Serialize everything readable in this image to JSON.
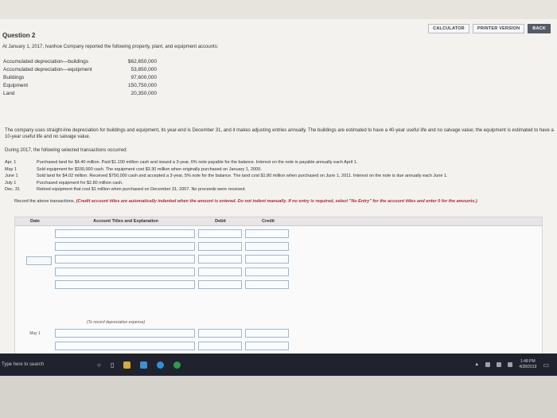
{
  "toolbar": {
    "calculator": "CALCULATOR",
    "printer_version": "PRINTER VERSION",
    "back": "BACK"
  },
  "question": {
    "title": "Question 2",
    "intro": "At January 1, 2017, Ivanhoe Company reported the following property, plant, and equipment accounts:"
  },
  "accounts": [
    {
      "name": "Accumulated depreciation—buildings",
      "value": "$62,650,000"
    },
    {
      "name": "Accumulated depreciation—equipment",
      "value": "53,850,000"
    },
    {
      "name": "Buildings",
      "value": "97,600,000"
    },
    {
      "name": "Equipment",
      "value": "150,750,000"
    },
    {
      "name": "Land",
      "value": "20,350,000"
    }
  ],
  "policy_text": "The company uses straight-line depreciation for buildings and equipment, its year-end is December 31, and it makes adjusting entries annually. The buildings are estimated to have a 40-year useful life and no salvage value; the equipment is estimated to have a 10-year useful life and no salvage value.",
  "during_text": "During 2017, the following selected transactions occurred:",
  "transactions": [
    {
      "date": "Apr. 1",
      "text": "Purchased land for $4.40 million. Paid $1.100 million cash and issued a 3-year, 6% note payable for the balance. Interest on the note is payable annually each April 1."
    },
    {
      "date": "May 1",
      "text": "Sold equipment for $330,000 cash. The equipment cost $3.30 million when originally purchased on January 1, 2009."
    },
    {
      "date": "June 1",
      "text": "Sold land for $4.02 million. Received $750,000 cash and accepted a 3-year, 5% note for the balance. The land cost $1.80 million when purchased on June 1, 2011. Interest on the note is due annually each June 1."
    },
    {
      "date": "July 1",
      "text": "Purchased equipment for $2.80 million cash."
    },
    {
      "date": "Dec. 31",
      "text": "Retired equipment that cost $1 million when purchased on December 31, 2007. No proceeds were received."
    }
  ],
  "instructions": {
    "lead": "Record the above transactions.",
    "red": "(Credit account titles are automatically indented when the amount is entered. Do not indent manually. If no entry is required, select \"No Entry\" for the account titles and enter 0 for the amounts.)"
  },
  "journal": {
    "headers": {
      "date": "Date",
      "account": "Account Titles and Explanation",
      "debit": "Debit",
      "credit": "Credit"
    },
    "note_depreciation": "(To record depreciation expense)",
    "date_may1": "May 1"
  },
  "taskbar": {
    "search_text": "Type here to search",
    "time": "1:48 PM",
    "date": "4/28/2019"
  }
}
